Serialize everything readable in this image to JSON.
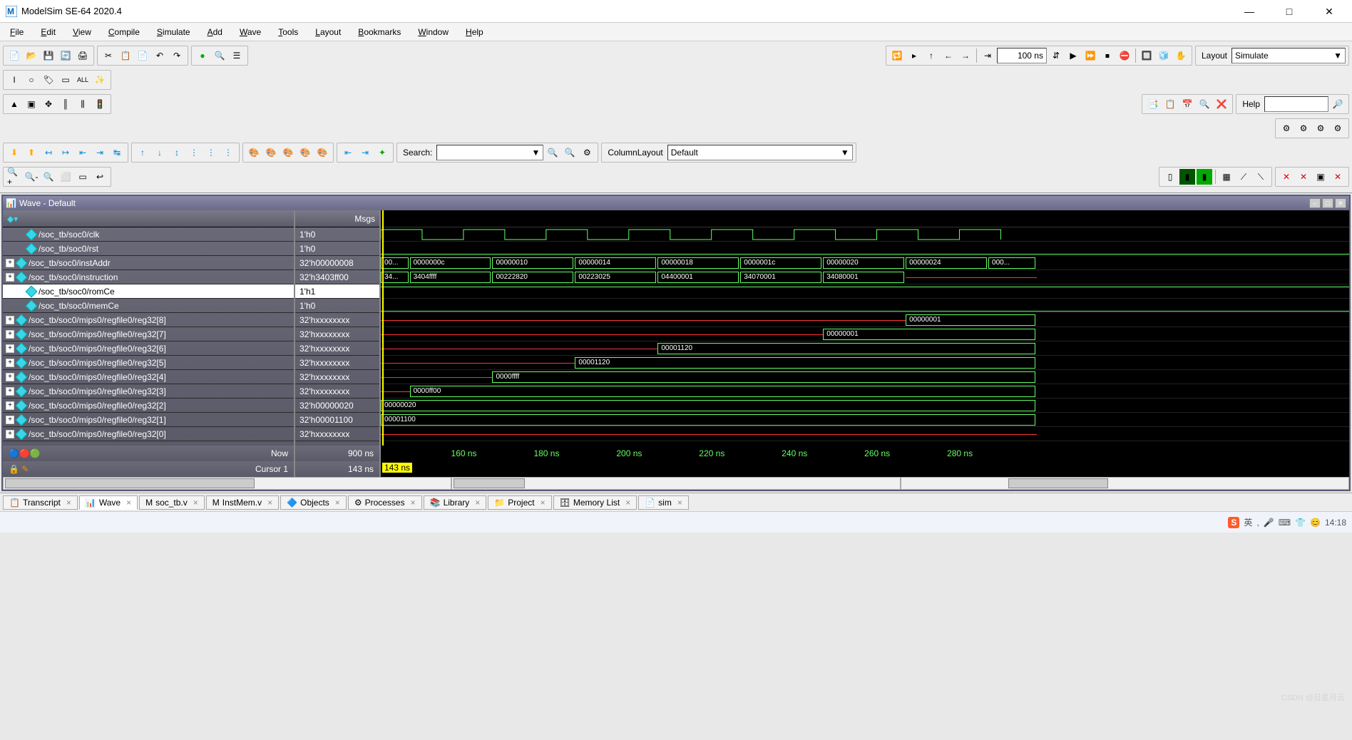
{
  "window": {
    "title": "ModelSim SE-64 2020.4",
    "buttons": {
      "min": "—",
      "max": "□",
      "close": "✕"
    }
  },
  "menu": [
    "File",
    "Edit",
    "View",
    "Compile",
    "Simulate",
    "Add",
    "Wave",
    "Tools",
    "Layout",
    "Bookmarks",
    "Window",
    "Help"
  ],
  "toolbar": {
    "time_box": "100 ns",
    "layout_label": "Layout",
    "layout_value": "Simulate",
    "help_label": "Help",
    "search_label": "Search:",
    "columnlayout_label": "ColumnLayout",
    "columnlayout_value": "Default"
  },
  "wave": {
    "title": "Wave - Default",
    "msgs_header": "Msgs",
    "signals": [
      {
        "exp": "",
        "name": "/soc_tb/soc0/clk",
        "msg": "1'h0",
        "sel": false
      },
      {
        "exp": "",
        "name": "/soc_tb/soc0/rst",
        "msg": "1'h0",
        "sel": false
      },
      {
        "exp": "+",
        "name": "/soc_tb/soc0/instAddr",
        "msg": "32'h00000008",
        "sel": false
      },
      {
        "exp": "+",
        "name": "/soc_tb/soc0/instruction",
        "msg": "32'h3403ff00",
        "sel": false
      },
      {
        "exp": "",
        "name": "/soc_tb/soc0/romCe",
        "msg": "1'h1",
        "sel": true
      },
      {
        "exp": "",
        "name": "/soc_tb/soc0/memCe",
        "msg": "1'h0",
        "sel": false
      },
      {
        "exp": "+",
        "name": "/soc_tb/soc0/mips0/regfile0/reg32[8]",
        "msg": "32'hxxxxxxxx",
        "sel": false
      },
      {
        "exp": "+",
        "name": "/soc_tb/soc0/mips0/regfile0/reg32[7]",
        "msg": "32'hxxxxxxxx",
        "sel": false
      },
      {
        "exp": "+",
        "name": "/soc_tb/soc0/mips0/regfile0/reg32[6]",
        "msg": "32'hxxxxxxxx",
        "sel": false
      },
      {
        "exp": "+",
        "name": "/soc_tb/soc0/mips0/regfile0/reg32[5]",
        "msg": "32'hxxxxxxxx",
        "sel": false
      },
      {
        "exp": "+",
        "name": "/soc_tb/soc0/mips0/regfile0/reg32[4]",
        "msg": "32'hxxxxxxxx",
        "sel": false
      },
      {
        "exp": "+",
        "name": "/soc_tb/soc0/mips0/regfile0/reg32[3]",
        "msg": "32'hxxxxxxxx",
        "sel": false
      },
      {
        "exp": "+",
        "name": "/soc_tb/soc0/mips0/regfile0/reg32[2]",
        "msg": "32'h00000020",
        "sel": false
      },
      {
        "exp": "+",
        "name": "/soc_tb/soc0/mips0/regfile0/reg32[1]",
        "msg": "32'h00001100",
        "sel": false
      },
      {
        "exp": "+",
        "name": "/soc_tb/soc0/mips0/regfile0/reg32[0]",
        "msg": "32'hxxxxxxxx",
        "sel": false
      }
    ],
    "footer": {
      "now_label": "Now",
      "now_value": "900 ns",
      "cursor_label": "Cursor 1",
      "cursor_value": "143 ns",
      "cursor_marker": "143 ns",
      "ticks": [
        "160 ns",
        "180 ns",
        "200 ns",
        "220 ns",
        "240 ns",
        "260 ns",
        "280 ns"
      ]
    },
    "chart_data": {
      "type": "table",
      "title": "Waveform bus values over time",
      "time_axis": {
        "unit": "ns",
        "start": 143,
        "end": 300,
        "clk_period": 20
      },
      "signals": {
        "clk": {
          "type": "clock",
          "period": 20
        },
        "rst": "0",
        "instAddr": [
          {
            "t": 143,
            "v": "00..."
          },
          {
            "t": 150,
            "v": "0000000c"
          },
          {
            "t": 170,
            "v": "00000010"
          },
          {
            "t": 190,
            "v": "00000014"
          },
          {
            "t": 210,
            "v": "00000018"
          },
          {
            "t": 230,
            "v": "0000001c"
          },
          {
            "t": 250,
            "v": "00000020"
          },
          {
            "t": 270,
            "v": "00000024"
          },
          {
            "t": 290,
            "v": "000..."
          }
        ],
        "instruction": [
          {
            "t": 143,
            "v": "34..."
          },
          {
            "t": 150,
            "v": "3404ffff"
          },
          {
            "t": 170,
            "v": "00222820"
          },
          {
            "t": 190,
            "v": "00223025"
          },
          {
            "t": 210,
            "v": "04400001"
          },
          {
            "t": 230,
            "v": "34070001"
          },
          {
            "t": 250,
            "v": "34080001"
          },
          {
            "t": 270,
            "v": ""
          }
        ],
        "romCe": "1",
        "memCe": "0",
        "reg32[8]": [
          {
            "t": 143,
            "v": "x"
          },
          {
            "t": 270,
            "v": "00000001"
          }
        ],
        "reg32[7]": [
          {
            "t": 143,
            "v": "x"
          },
          {
            "t": 250,
            "v": "00000001"
          }
        ],
        "reg32[6]": [
          {
            "t": 143,
            "v": "x"
          },
          {
            "t": 210,
            "v": "00001120"
          }
        ],
        "reg32[5]": [
          {
            "t": 143,
            "v": "x"
          },
          {
            "t": 190,
            "v": "00001120"
          }
        ],
        "reg32[4]": [
          {
            "t": 143,
            "v": "x"
          },
          {
            "t": 170,
            "v": "0000ffff"
          }
        ],
        "reg32[3]": [
          {
            "t": 143,
            "v": "x"
          },
          {
            "t": 150,
            "v": "0000ff00"
          }
        ],
        "reg32[2]": [
          {
            "t": 143,
            "v": "00000020"
          }
        ],
        "reg32[1]": [
          {
            "t": 143,
            "v": "00001100"
          }
        ],
        "reg32[0]": [
          {
            "t": 143,
            "v": "x"
          }
        ]
      }
    }
  },
  "tabs": [
    {
      "label": "Transcript",
      "icon": "📋"
    },
    {
      "label": "Wave",
      "icon": "📊",
      "active": true
    },
    {
      "label": "soc_tb.v",
      "icon": "M"
    },
    {
      "label": "InstMem.v",
      "icon": "M"
    },
    {
      "label": "Objects",
      "icon": "🔷"
    },
    {
      "label": "Processes",
      "icon": "⚙"
    },
    {
      "label": "Library",
      "icon": "📚"
    },
    {
      "label": "Project",
      "icon": "📁"
    },
    {
      "label": "Memory List",
      "icon": "🗄"
    },
    {
      "label": "sim",
      "icon": "📄"
    }
  ],
  "tray": {
    "badge": "S",
    "lang": "英",
    "time": "14:18"
  },
  "watermark": "CSDN @日星月云"
}
